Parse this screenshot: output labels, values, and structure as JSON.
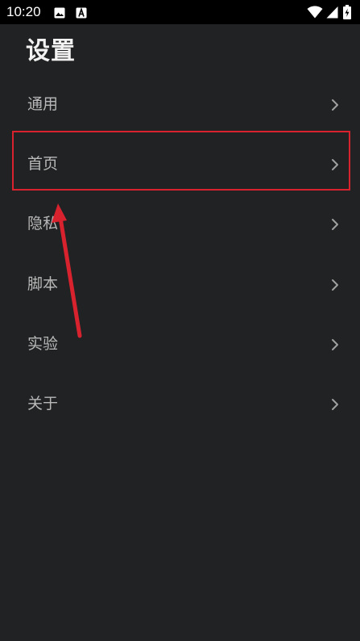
{
  "status_bar": {
    "time": "10:20",
    "icons_left": [
      "image-icon",
      "font-a-icon"
    ],
    "icons_right": [
      "wifi-icon",
      "signal-icon",
      "battery-charging-icon"
    ]
  },
  "page": {
    "title": "设置"
  },
  "menu": {
    "items": [
      {
        "label": "通用"
      },
      {
        "label": "首页"
      },
      {
        "label": "隐私"
      },
      {
        "label": "脚本"
      },
      {
        "label": "实验"
      },
      {
        "label": "关于"
      }
    ]
  },
  "annotation": {
    "highlighted_item": "首页",
    "color": "#d8232f"
  },
  "colors": {
    "background": "#212223",
    "status_bar": "#000000",
    "title_text": "#f2f2f2",
    "item_text": "#b8b8b8",
    "chevron": "#a0a0a0"
  }
}
